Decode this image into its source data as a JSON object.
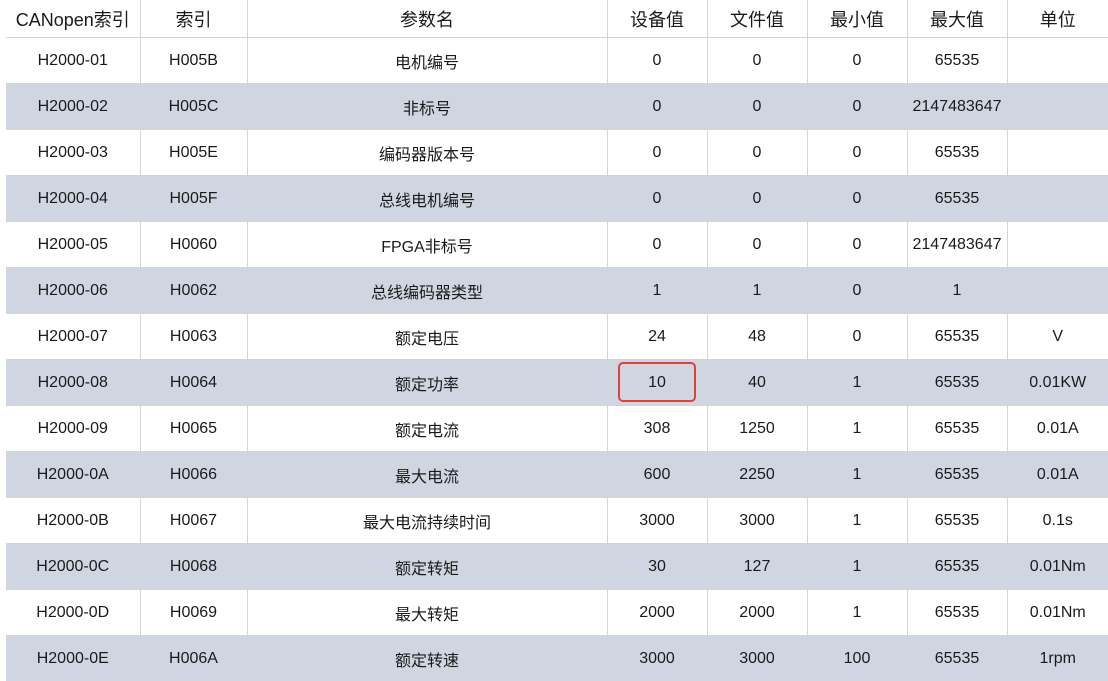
{
  "columns": [
    "CANopen索引",
    "索引",
    "参数名",
    "设备值",
    "文件值",
    "最小值",
    "最大值",
    "单位"
  ],
  "rows": [
    {
      "canopen": "H2000-01",
      "index": "H005B",
      "name": "电机编号",
      "device": "0",
      "file": "0",
      "min": "0",
      "max": "65535",
      "unit": ""
    },
    {
      "canopen": "H2000-02",
      "index": "H005C",
      "name": "非标号",
      "device": "0",
      "file": "0",
      "min": "0",
      "max": "2147483647",
      "unit": ""
    },
    {
      "canopen": "H2000-03",
      "index": "H005E",
      "name": "编码器版本号",
      "device": "0",
      "file": "0",
      "min": "0",
      "max": "65535",
      "unit": ""
    },
    {
      "canopen": "H2000-04",
      "index": "H005F",
      "name": "总线电机编号",
      "device": "0",
      "file": "0",
      "min": "0",
      "max": "65535",
      "unit": ""
    },
    {
      "canopen": "H2000-05",
      "index": "H0060",
      "name": "FPGA非标号",
      "device": "0",
      "file": "0",
      "min": "0",
      "max": "2147483647",
      "unit": ""
    },
    {
      "canopen": "H2000-06",
      "index": "H0062",
      "name": "总线编码器类型",
      "device": "1",
      "file": "1",
      "min": "0",
      "max": "1",
      "unit": ""
    },
    {
      "canopen": "H2000-07",
      "index": "H0063",
      "name": "额定电压",
      "device": "24",
      "file": "48",
      "min": "0",
      "max": "65535",
      "unit": "V"
    },
    {
      "canopen": "H2000-08",
      "index": "H0064",
      "name": "额定功率",
      "device": "10",
      "file": "40",
      "min": "1",
      "max": "65535",
      "unit": "0.01KW"
    },
    {
      "canopen": "H2000-09",
      "index": "H0065",
      "name": "额定电流",
      "device": "308",
      "file": "1250",
      "min": "1",
      "max": "65535",
      "unit": "0.01A"
    },
    {
      "canopen": "H2000-0A",
      "index": "H0066",
      "name": "最大电流",
      "device": "600",
      "file": "2250",
      "min": "1",
      "max": "65535",
      "unit": "0.01A"
    },
    {
      "canopen": "H2000-0B",
      "index": "H0067",
      "name": "最大电流持续时间",
      "device": "3000",
      "file": "3000",
      "min": "1",
      "max": "65535",
      "unit": "0.1s"
    },
    {
      "canopen": "H2000-0C",
      "index": "H0068",
      "name": "额定转矩",
      "device": "30",
      "file": "127",
      "min": "1",
      "max": "65535",
      "unit": "0.01Nm"
    },
    {
      "canopen": "H2000-0D",
      "index": "H0069",
      "name": "最大转矩",
      "device": "2000",
      "file": "2000",
      "min": "1",
      "max": "65535",
      "unit": "0.01Nm"
    },
    {
      "canopen": "H2000-0E",
      "index": "H006A",
      "name": "额定转速",
      "device": "3000",
      "file": "3000",
      "min": "100",
      "max": "65535",
      "unit": "1rpm"
    }
  ],
  "highlight": {
    "row": 7,
    "column": "device",
    "color": "#e0403a"
  },
  "colors": {
    "stripe": "#d0d6e1",
    "grid": "#d4d4d4"
  }
}
